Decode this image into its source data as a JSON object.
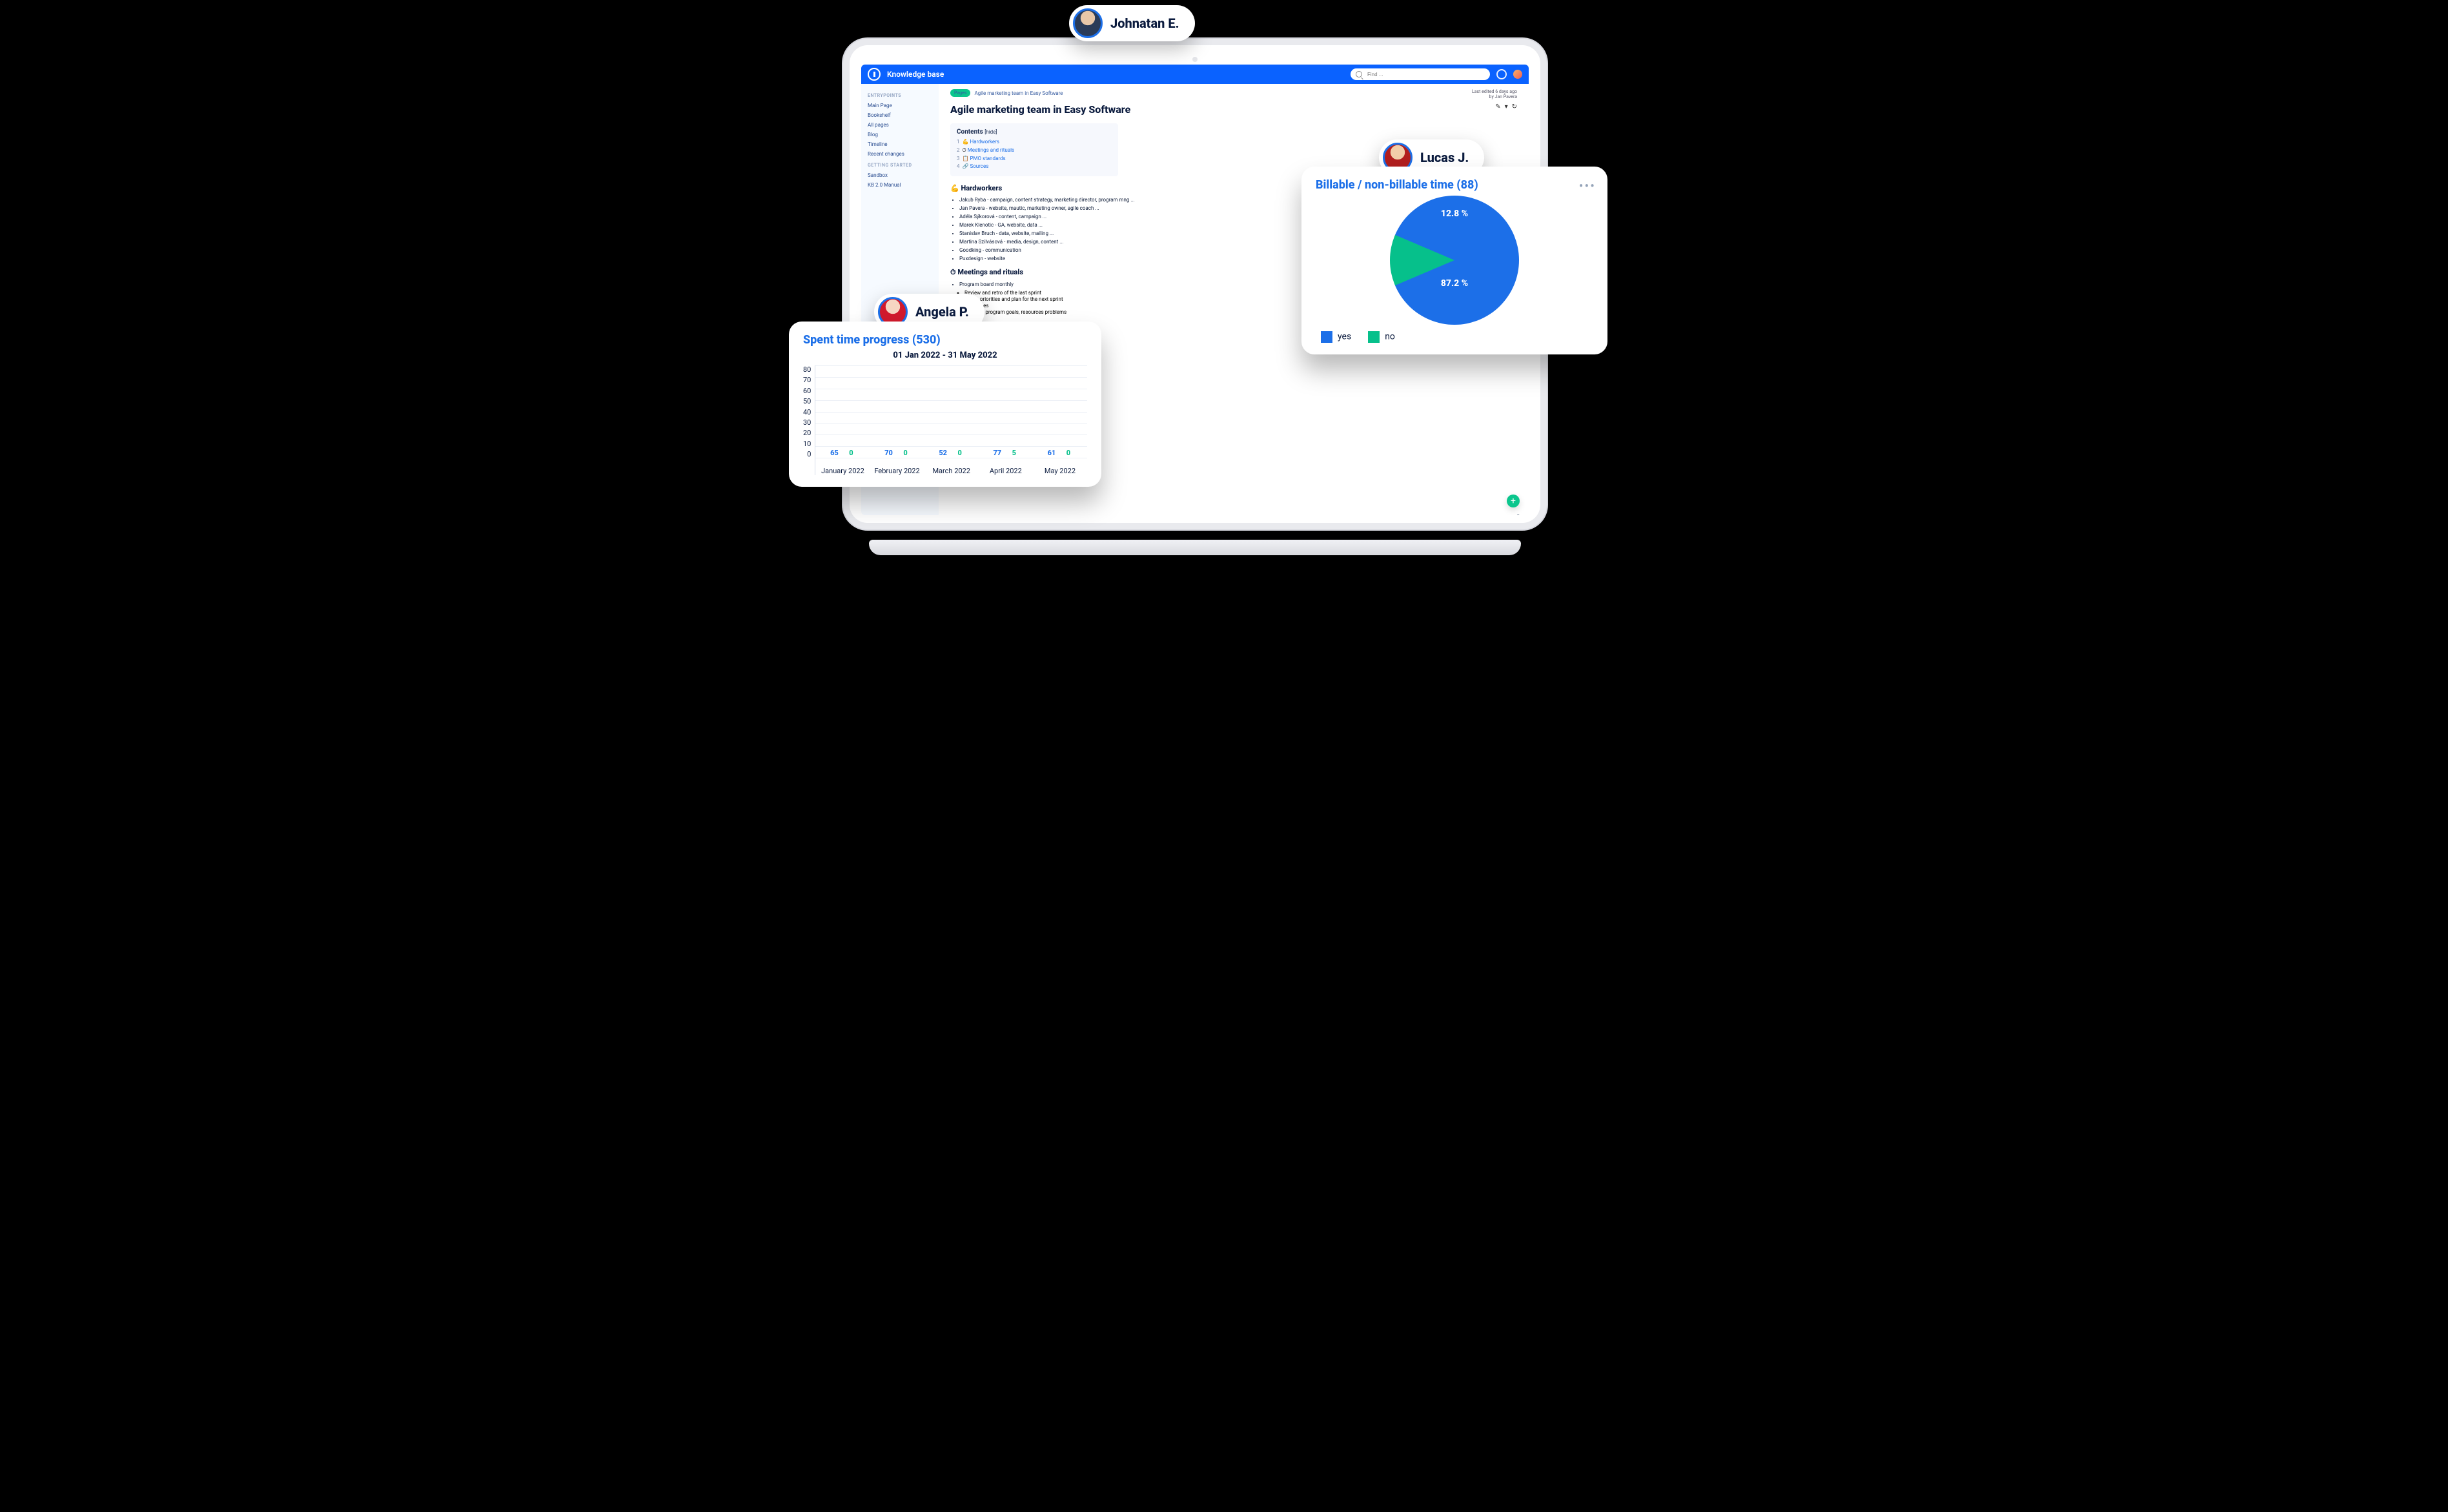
{
  "app_title": "Knowledge base",
  "search": {
    "placeholder": "Find ..."
  },
  "sidebar": {
    "groups": [
      {
        "label": "ENTRYPOINTS",
        "items": [
          "Main Page",
          "Bookshelf",
          "All pages",
          "Blog",
          "Timeline",
          "Recent changes"
        ]
      },
      {
        "label": "GETTING STARTED",
        "items": [
          "Sandbox",
          "KB 2.0 Manual"
        ]
      }
    ]
  },
  "crumb": {
    "pill": "Pages",
    "text": "Agile marketing team in Easy Software"
  },
  "page_title": "Agile marketing team in Easy Software",
  "meta": {
    "l1": "Last edited 6 days ago",
    "l2": "by Jan Pavera"
  },
  "contents": {
    "title": "Contents",
    "hide": "[hide]",
    "items": [
      {
        "num": "1",
        "emoji": "💪",
        "label": "Hardworkers"
      },
      {
        "num": "2",
        "emoji": "⏱",
        "label": "Meetings and rituals"
      },
      {
        "num": "3",
        "emoji": "📋",
        "label": "PMO standards"
      },
      {
        "num": "4",
        "emoji": "🔗",
        "label": "Sources"
      }
    ]
  },
  "section1": {
    "emoji": "💪",
    "title": "Hardworkers",
    "items": [
      "Jakub Ryba - campaign, content strategy, marketing director, program mng ...",
      "Jan Pavera - website, mautic, marketing owner, agile coach ...",
      "Adéla Sýkorová - content, campaign ...",
      "Marek Klenotic - GA, website, data ...",
      "Stanislav Bruch - data, website, mailing ...",
      "Martina Szilvásová - media, design, content ...",
      "Goodking - communication",
      "Puxdesign - website"
    ]
  },
  "section2": {
    "emoji": "⏱",
    "title": "Meetings and rituals",
    "items": [
      {
        "text": "Program board monthly",
        "sub": [
          "Review and retro of the last sprint",
          "Goals, priorities and plan for the next sprint",
          "Resources",
          "Escalate program goals, resources problems"
        ]
      }
    ]
  },
  "users": {
    "top": "Johnatan E.",
    "left": "Angela P.",
    "right": "Lucas J."
  },
  "card_bar": {
    "title": "Spent time progress (530)",
    "subtitle": "01 Jan 2022 - 31 May 2022"
  },
  "card_pie": {
    "title": "Billable / non-billable time (88)",
    "legend": [
      "yes",
      "no"
    ]
  },
  "chart_data": [
    {
      "type": "bar",
      "title": "Spent time progress (530)",
      "subtitle": "01 Jan 2022 - 31 May 2022",
      "categories": [
        "January 2022",
        "February 2022",
        "March 2022",
        "April 2022",
        "May 2022"
      ],
      "series": [
        {
          "name": "blue",
          "color": "#1C6FE8",
          "values": [
            65,
            70,
            52,
            77,
            61
          ]
        },
        {
          "name": "green",
          "color": "#06C08B",
          "values": [
            0,
            0,
            0,
            5,
            0
          ]
        }
      ],
      "y_ticks": [
        0,
        10,
        20,
        30,
        40,
        50,
        60,
        70,
        80
      ],
      "ylim": [
        0,
        80
      ]
    },
    {
      "type": "pie",
      "title": "Billable / non-billable time (88)",
      "series": [
        {
          "name": "yes",
          "value": 87.2,
          "label": "87.2 %",
          "color": "#1C6FE8"
        },
        {
          "name": "no",
          "value": 12.8,
          "label": "12.8 %",
          "color": "#06C08B"
        }
      ]
    }
  ]
}
